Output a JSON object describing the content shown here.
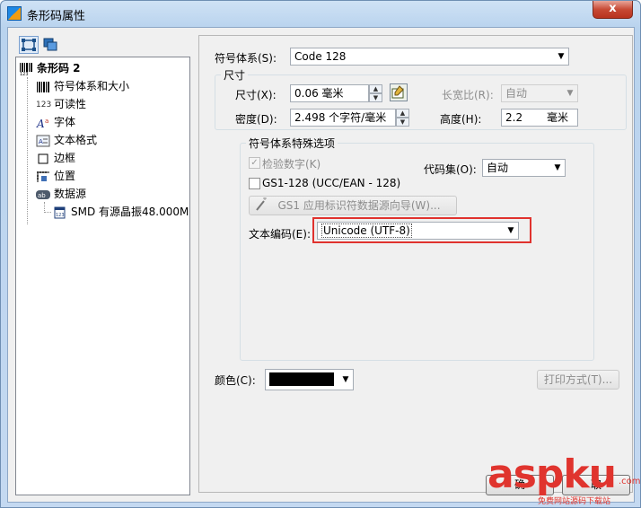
{
  "window": {
    "title": "条形码属性",
    "close_label": "x"
  },
  "tree": {
    "root": "条形码 2",
    "items": [
      {
        "label": "符号体系和大小",
        "icon": "barcode-icon"
      },
      {
        "label": "可读性",
        "icon": "numbers-icon",
        "icon_text": "123"
      },
      {
        "label": "字体",
        "icon": "font-icon"
      },
      {
        "label": "文本格式",
        "icon": "text-format-icon"
      },
      {
        "label": "边框",
        "icon": "border-icon"
      },
      {
        "label": "位置",
        "icon": "position-icon"
      },
      {
        "label": "数据源",
        "icon": "datasource-icon"
      }
    ],
    "child": "SMD 有源晶振48.000M"
  },
  "form": {
    "symbology_label": "符号体系(S):",
    "symbology_value": "Code 128",
    "size_group": "尺寸",
    "size_label": "尺寸(X):",
    "size_value": "0.06 毫米",
    "density_label": "密度(D):",
    "density_value": "2.498 个字符/毫米",
    "aspect_label": "长宽比(R):",
    "aspect_value": "自动",
    "height_label": "高度(H):",
    "height_value": "2.2",
    "height_unit": "毫米",
    "special_group": "符号体系特殊选项",
    "checkdigit_label": "检验数字(K)",
    "gs1_label": "GS1-128 (UCC/EAN - 128)",
    "gs1_wizard_label": "GS1 应用标识符数据源向导(W)...",
    "codeset_label": "代码集(O):",
    "codeset_value": "自动",
    "encoding_label": "文本编码(E):",
    "encoding_value": "Unicode (UTF-8)",
    "color_label": "颜色(C):",
    "color_value": "#000000",
    "print_method_label": "打印方式(T)..."
  },
  "footer": {
    "ok_label": "确",
    "cancel_label": "取"
  },
  "watermark": {
    "brand": "aspku",
    "sub": "免费网站源码下载站",
    "domain_suffix": ".com"
  },
  "colors": {
    "highlight": "#e0322e",
    "accent": "#3c7fb1"
  }
}
